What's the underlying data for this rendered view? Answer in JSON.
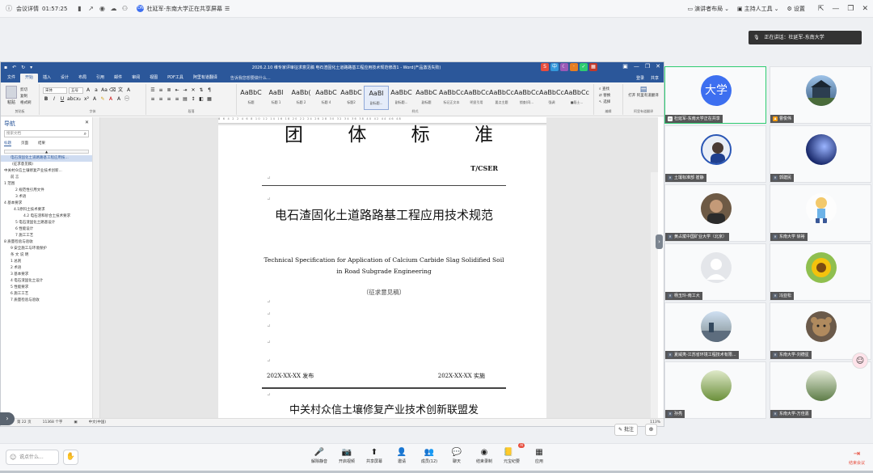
{
  "topbar": {
    "meeting_info": "会议详情",
    "time": "01:57:25",
    "share_text": "杜延军-东南大学正在共享屏幕",
    "share_dot": "DN",
    "speaker_layout": "演讲者布局",
    "host_ai": "主持人工具",
    "settings": "设置"
  },
  "word": {
    "title": "2026.2.10 维专家评审征求意见稿 电石渣固化土道路路基工程应用技术规范修改1 - Word(产品激活失败)",
    "tabs": [
      "文件",
      "开始",
      "插入",
      "设计",
      "布局",
      "引用",
      "邮件",
      "审阅",
      "视图",
      "PDF工具",
      "阿里有道翻译"
    ],
    "tell_me": "告诉我您想要做什么...",
    "right_tabs": [
      "登录",
      "共享"
    ],
    "ribbon": {
      "paste": "粘贴",
      "clip_items": [
        "剪切",
        "复制",
        "格式刷"
      ],
      "clip_label": "剪贴板",
      "font_name": "宋体",
      "font_size": "五号",
      "font_label": "字体",
      "para_label": "段落",
      "styles": [
        {
          "preview": "AaBbC",
          "name": "标题"
        },
        {
          "preview": "AaBl",
          "name": "标题 1"
        },
        {
          "preview": "AaBb(",
          "name": "标题 2"
        },
        {
          "preview": "AaBbC",
          "name": "标题 4"
        },
        {
          "preview": "AaBbC",
          "name": "标题2"
        },
        {
          "preview": "AaBl",
          "name": "副标题..."
        },
        {
          "preview": "AaBbC",
          "name": "副标题..."
        },
        {
          "preview": "AaBbC",
          "name": "副标题"
        },
        {
          "preview": "AaBbCcDd",
          "name": "标记正文本"
        },
        {
          "preview": "AaBbCcDd",
          "name": "明显引用"
        },
        {
          "preview": "AaBbCcDd",
          "name": "要点主题"
        },
        {
          "preview": "AaBbCcD",
          "name": "锁查(同..."
        },
        {
          "preview": "AaBbCcD",
          "name": "强调"
        },
        {
          "preview": "AaBbCcD",
          "name": "■段士..."
        }
      ],
      "styles_label": "样式",
      "edit_items": [
        "查找",
        "替换",
        "选择"
      ],
      "edit_label": "编辑",
      "translate": "打开 阿里有道翻译",
      "translate_label": "阿里有道翻译"
    },
    "nav": {
      "title": "导航",
      "search": "搜索文档",
      "tabs": [
        "标题",
        "页面",
        "结果"
      ],
      "items": [
        "电石渣固化土道路路基工程应用技...",
        "(征求意见稿)",
        "中关村众信土壤修复产业技术创新...",
        "",
        "前 言",
        "1 范围",
        "2 规范性引用文件",
        "3 术语",
        "4 基本要求",
        "4.1原料土技术要求",
        "4.2 电石渣和砂合土技术要求",
        "5 电石渣固化土路基设计",
        "6 性能设计",
        "7 施工工艺",
        "8 质量检验与验收",
        "",
        "9 安全施工与环境保护",
        "条 文 说 明",
        "",
        "1 总则",
        "2 术语",
        "3 基本要求",
        "4 电石渣固化土设计",
        "5 性能要求",
        "6 施工工艺",
        "7 质量检验与验收"
      ]
    },
    "ruler": "8 6 4 2 2 4 6 8 10 12 14 16 18 20 22 24 26 28 30 32 34 36 38 40 42 44 46 48",
    "doc": {
      "header_chars": [
        "团",
        "体",
        "标",
        "准"
      ],
      "code": "T/CSER",
      "title": "电石渣固化土道路路基工程应用技术规范",
      "en_title": "Technical Specification for Application of Calcium Carbide Slag Solidified Soil in Road Subgrade Engineering",
      "draft": "（征求意见稿）",
      "issue": "202X-XX-XX 发布",
      "implement": "202X-XX-XX 实施",
      "org": "中关村众信土壤修复产业技术创新联盟发"
    },
    "status": [
      "第 22 页",
      "11368 个字",
      "中文(中国)"
    ],
    "zoom": "113%"
  },
  "annotate_btn": "批注",
  "speaking": "正在讲话：杜延军-东南大学",
  "participants": [
    {
      "name": "杜延军-东南大学正在共享",
      "avatar_text": "大学",
      "icon": "share-icon"
    },
    {
      "name": "曹俊伟",
      "icon": "host-icon"
    },
    {
      "name": "土壤标准部 崔静",
      "icon": "mic-off-icon"
    },
    {
      "name": "郭建民",
      "icon": "mic-off-icon"
    },
    {
      "name": "黄占斌中国矿业大学（北京）",
      "icon": "mic-off-icon"
    },
    {
      "name": "东南大学 徐裕",
      "icon": "mic-off-icon"
    },
    {
      "name": "杨玉玲-南工大",
      "icon": "mic-off-icon"
    },
    {
      "name": "冯亚松",
      "icon": "mic-off-icon"
    },
    {
      "name": "夏威夷-江苏省环境工程技术有限...",
      "icon": "mic-off-icon"
    },
    {
      "name": "东南大学-刘德星",
      "icon": "mic-off-icon"
    },
    {
      "name": "孙亮",
      "icon": "mic-off-icon"
    },
    {
      "name": "东南大学-万佳嘉",
      "icon": "mic-off-icon"
    }
  ],
  "bottom": {
    "chat_placeholder": "说点什么...",
    "controls": [
      {
        "label": "解除静音",
        "icon": "mic-off-icon"
      },
      {
        "label": "开启视频",
        "icon": "camera-off-icon"
      },
      {
        "label": "共享屏幕",
        "icon": "share-screen-icon"
      },
      {
        "label": "邀请",
        "icon": "invite-icon"
      },
      {
        "label": "成员(12)",
        "icon": "members-icon"
      },
      {
        "label": "聊天",
        "icon": "chat-icon"
      },
      {
        "label": "结束录制",
        "icon": "record-icon"
      },
      {
        "label": "元宝纪要",
        "icon": "notes-icon",
        "badge": "AI"
      },
      {
        "label": "应用",
        "icon": "apps-icon"
      }
    ],
    "leave": "结束会议"
  }
}
